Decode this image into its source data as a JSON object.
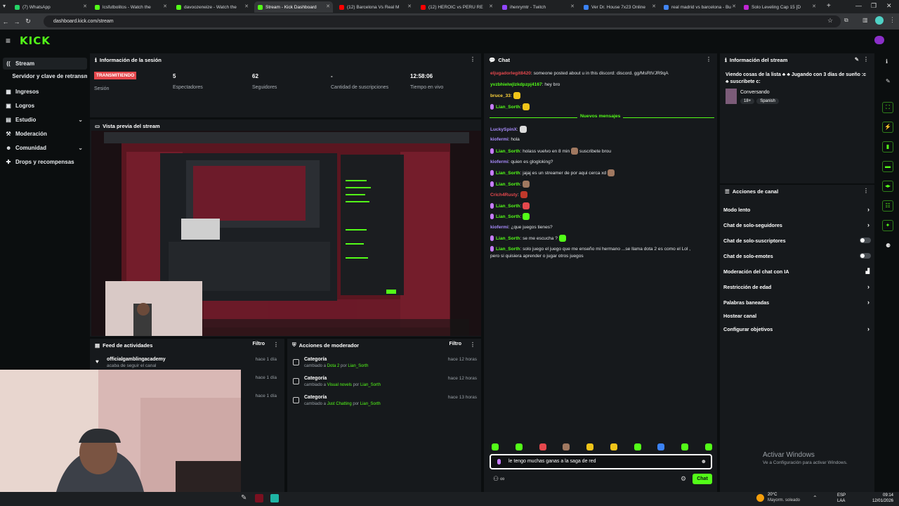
{
  "browser": {
    "tabs": [
      {
        "label": "(7) WhatsApp",
        "color": "#25d366"
      },
      {
        "label": "lcsfutbolitos - Watch the",
        "color": "#53fc18"
      },
      {
        "label": "davoozeneize - Watch the",
        "color": "#53fc18"
      },
      {
        "label": "Stream - Kick Dashboard",
        "color": "#53fc18"
      },
      {
        "label": "(12) Barcelona Vs Real M",
        "color": "#ff0000"
      },
      {
        "label": "(12) HEROIC vs PERU RE",
        "color": "#ff0000"
      },
      {
        "label": "ihenrymtr - Twitch",
        "color": "#9146ff"
      },
      {
        "label": "Ver Dr. House 7x23 Online",
        "color": "#3b82f6"
      },
      {
        "label": "real madrid vs barcelona - Bu",
        "color": "#4285f4"
      },
      {
        "label": "Solo Leveling Cap 15 [D",
        "color": "#c026d3"
      }
    ],
    "active_tab_index": 3,
    "url": "dashboard.kick.com/stream"
  },
  "header": {
    "logo": "KICK"
  },
  "sidebar": {
    "items": [
      {
        "label": "Stream",
        "icon": "broadcast-icon",
        "active": true
      },
      {
        "label": "Servidor y clave de retransmisión",
        "icon": "",
        "active": false
      },
      {
        "label": "Ingresos",
        "icon": "money-icon",
        "active": false
      },
      {
        "label": "Logros",
        "icon": "trophy-icon",
        "active": false
      },
      {
        "label": "Estudio",
        "icon": "studio-icon",
        "active": false,
        "chevron": true
      },
      {
        "label": "Moderación",
        "icon": "gavel-icon",
        "active": false
      },
      {
        "label": "Comunidad",
        "icon": "people-icon",
        "active": false,
        "chevron": true
      },
      {
        "label": "Drops y recompensas",
        "icon": "gift-icon",
        "active": false
      }
    ]
  },
  "session": {
    "title": "Información de la sesión",
    "live_badge": "TRANSMITIENDO",
    "session_label": "Sesión",
    "stats": [
      {
        "value": "5",
        "label": "Espectadores"
      },
      {
        "value": "62",
        "label": "Seguidores"
      },
      {
        "value": "-",
        "label": "Cantidad de suscripciones"
      },
      {
        "value": "12:58:06",
        "label": "Tiempo en vivo"
      }
    ]
  },
  "preview": {
    "title": "Vista previa del stream"
  },
  "activity": {
    "title": "Feed de actividades",
    "filter_label": "Filtro",
    "rows": [
      {
        "name": "officialgamblingacademy",
        "text": "acaba de seguir el canal",
        "time": "hace 1 día"
      },
      {
        "name": "",
        "text": "",
        "time": "hace 1 día"
      },
      {
        "name": "",
        "text": "",
        "time": "hace 1 día"
      }
    ]
  },
  "modactions": {
    "title": "Acciones de moderador",
    "filter_label": "Filtro",
    "rows": [
      {
        "title": "Categoría",
        "pre": "cambiado a ",
        "category": "Dota 2",
        "mid": " por ",
        "user": "Lian_Sorth",
        "time": "hace 12 horas"
      },
      {
        "title": "Categoría",
        "pre": "cambiado a ",
        "category": "Visual novels",
        "mid": " por ",
        "user": "Lian_Sorth",
        "time": "hace 12 horas"
      },
      {
        "title": "Categoría",
        "pre": "cambiado a ",
        "category": "Just Chatting",
        "mid": " por ",
        "user": "Lian_Sorth",
        "time": "hace 13 horas"
      }
    ]
  },
  "chat": {
    "title": "Chat",
    "new_messages": "Nuevos mensajes",
    "messages": [
      {
        "user": "eljugadorlegit8420",
        "color": "#e5484d",
        "text": ": someone posted about u in this discord: discord. gg/MsRtVJR9qA",
        "badge": false,
        "emote": ""
      },
      {
        "user": "yvzbhielwjlzkdpzpj4167",
        "color": "#53fc18",
        "text": ": hey bro",
        "badge": false,
        "emote": ""
      },
      {
        "user": "bruce_33",
        "color": "#ffd43b",
        "text": ":",
        "badge": false,
        "emote": "#f0c419"
      },
      {
        "user": "Lian_Sorth",
        "color": "#53fc18",
        "text": ":",
        "badge": true,
        "emote": "#f0c419"
      },
      {
        "user": "LuckySpinX",
        "color": "#a78bfa",
        "text": ":",
        "badge": false,
        "emote": "#dddddd"
      },
      {
        "user": "kiofermi",
        "color": "#a78bfa",
        "text": ": hola",
        "badge": false,
        "emote": ""
      },
      {
        "user": "Lian_Sorth",
        "color": "#53fc18",
        "text": ": holass vuelvo en 8 min",
        "badge": true,
        "emote": "#a07860",
        "after": " suscribete brou"
      },
      {
        "user": "kiofermi",
        "color": "#a78bfa",
        "text": ": quien es glogloking?",
        "badge": false,
        "emote": ""
      },
      {
        "user": "Lian_Sorth",
        "color": "#53fc18",
        "text": ": jajaj es un streamer de por aqui cerca xd",
        "badge": true,
        "emote": "#a07860"
      },
      {
        "user": "Lian_Sorth",
        "color": "#53fc18",
        "text": ":",
        "badge": true,
        "emote": "#a07860"
      },
      {
        "user": "Crich4Rusty",
        "color": "#e5484d",
        "text": ":",
        "badge": false,
        "emote": "#c0392b"
      },
      {
        "user": "Lian_Sorth",
        "color": "#53fc18",
        "text": ":",
        "badge": true,
        "emote": "#e5484d"
      },
      {
        "user": "Lian_Sorth",
        "color": "#53fc18",
        "text": ":",
        "badge": true,
        "emote": "#53fc18"
      },
      {
        "user": "kiofermi",
        "color": "#a78bfa",
        "text": ": ¿que juegos tienes?",
        "badge": false,
        "emote": ""
      },
      {
        "user": "Lian_Sorth",
        "color": "#53fc18",
        "text": ": se me escucha ?",
        "badge": true,
        "emote": "#53fc18"
      },
      {
        "user": "Lian_Sorth",
        "color": "#53fc18",
        "text": ": solo juego el juego que me enseño mi hermano ...se llama dota 2 es como el Lol ,",
        "badge": true,
        "emote": ""
      }
    ],
    "continuation": "pero si quisiera aprender o jugar otros juegos",
    "input_value": "le tengo muchas ganas a la saga de red",
    "send_label": "Chat"
  },
  "stream_info": {
    "title": "Información del stream",
    "stream_title": "Viendo cosas de la lista ♣ ♣ Jugando con 3 días de sueño :c ♣ suscribete c:",
    "category": "Conversando",
    "tags": [
      "18+",
      "Spanish"
    ]
  },
  "channel_actions": {
    "title": "Acciones de canal",
    "items": [
      {
        "label": "Modo lento",
        "kind": "arrow"
      },
      {
        "label": "Chat de solo-seguidores",
        "kind": "arrow"
      },
      {
        "label": "Chat de solo-suscriptores",
        "kind": "toggle"
      },
      {
        "label": "Chat de solo-emotes",
        "kind": "toggle"
      },
      {
        "label": "Moderación del chat con IA",
        "kind": "icon"
      },
      {
        "label": "Restricción de edad",
        "kind": "arrow"
      },
      {
        "label": "Palabras baneadas",
        "kind": "arrow"
      },
      {
        "label": "Hostear canal",
        "kind": "none"
      },
      {
        "label": "Configurar objetivos",
        "kind": "arrow"
      }
    ]
  },
  "windows_watermark": {
    "line1": "Activar Windows",
    "line2": "Ve a Configuración para activar Windows."
  },
  "taskbar": {
    "weather_temp": "20°C",
    "weather_desc": "Mayorm. soleado",
    "lang": "ESP",
    "lang2": "LAA",
    "time": "09:14",
    "date": "12/01/2026"
  },
  "colors": {
    "brand": "#53fc18",
    "live": "#e5484d",
    "panel": "#16191c"
  }
}
